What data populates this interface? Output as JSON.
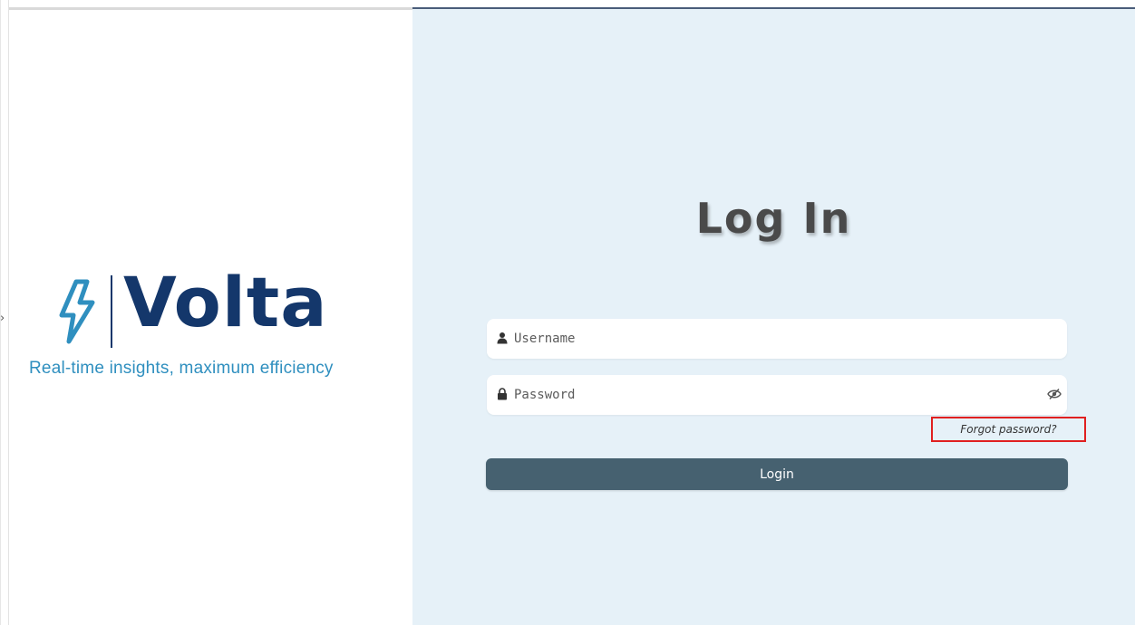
{
  "brand": {
    "name": "Volta",
    "tagline": "Real-time insights, maximum efficiency",
    "colors": {
      "primary": "#14376b",
      "accent": "#2f8fbf"
    },
    "icon": "lightning-bolt-icon"
  },
  "login": {
    "title": "Log In",
    "username": {
      "placeholder": "Username",
      "value": "",
      "icon": "user-icon"
    },
    "password": {
      "placeholder": "Password",
      "value": "",
      "icon": "lock-icon",
      "toggle_icon": "eye-slash-icon"
    },
    "forgot_password_label": "Forgot password?",
    "submit_label": "Login",
    "colors": {
      "panel_bg": "#e6f1f8",
      "button_bg": "#466170",
      "highlight_border": "#e02020"
    }
  }
}
